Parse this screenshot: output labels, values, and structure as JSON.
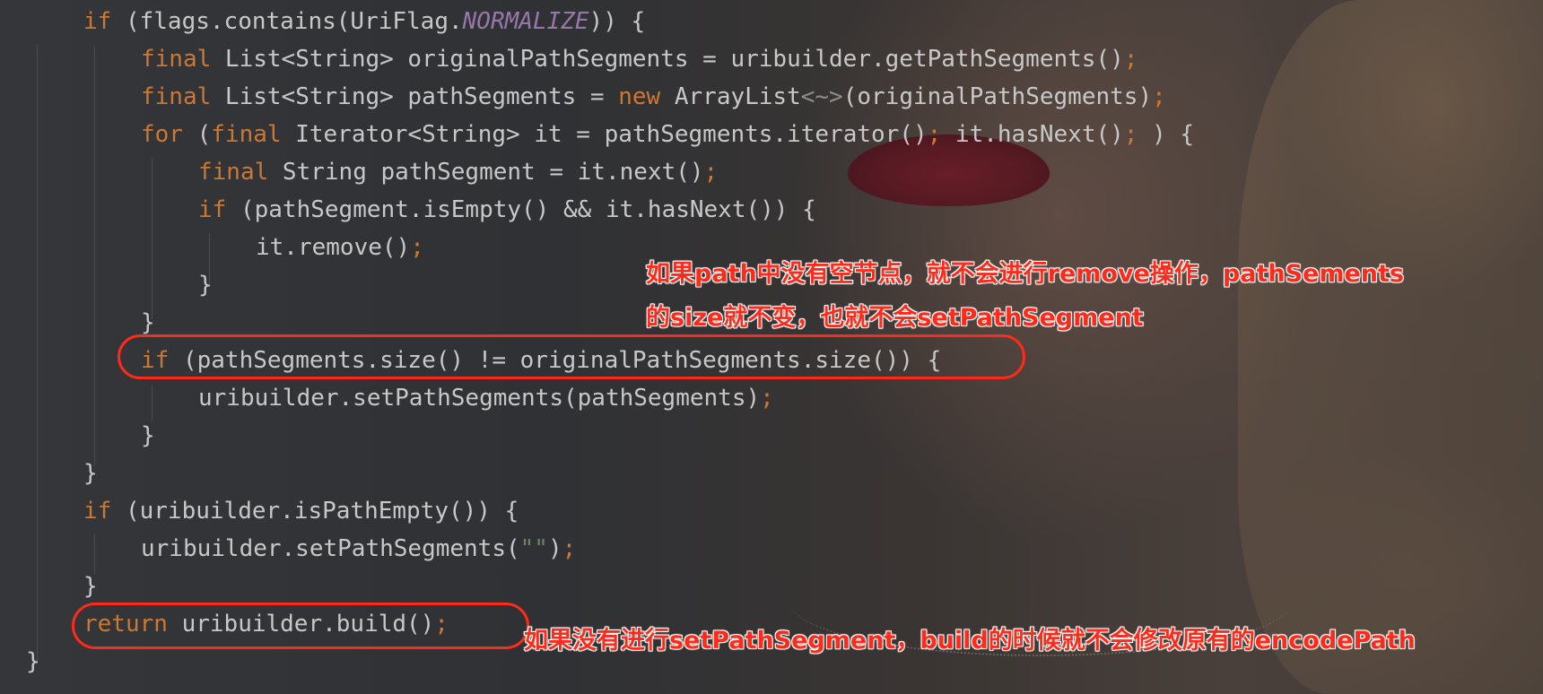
{
  "code": {
    "lines": [
      [
        {
          "t": "kw",
          "v": "if"
        },
        {
          "t": "tx",
          "v": " (flags.contains(UriFlag."
        },
        {
          "t": "const",
          "v": "NORMALIZE"
        },
        {
          "t": "tx",
          "v": ")) {"
        }
      ],
      [
        {
          "t": "kw",
          "v": "final"
        },
        {
          "t": "tx",
          "v": " List<String> originalPathSegments = uribuilder.getPathSegments()"
        },
        {
          "t": "kw",
          "v": ";"
        }
      ],
      [
        {
          "t": "kw",
          "v": "final"
        },
        {
          "t": "tx",
          "v": " List<String> pathSegments = "
        },
        {
          "t": "kw",
          "v": "new"
        },
        {
          "t": "tx",
          "v": " ArrayList"
        },
        {
          "t": "gray",
          "v": "<~>"
        },
        {
          "t": "tx",
          "v": "(originalPathSegments)"
        },
        {
          "t": "kw",
          "v": ";"
        }
      ],
      [
        {
          "t": "kw",
          "v": "for"
        },
        {
          "t": "tx",
          "v": " ("
        },
        {
          "t": "kw",
          "v": "final"
        },
        {
          "t": "tx",
          "v": " Iterator<String> it = pathSegments.iterator()"
        },
        {
          "t": "kw",
          "v": ";"
        },
        {
          "t": "tx",
          "v": " it.hasNext()"
        },
        {
          "t": "kw",
          "v": ";"
        },
        {
          "t": "tx",
          "v": " ) {"
        }
      ],
      [
        {
          "t": "kw",
          "v": "final"
        },
        {
          "t": "tx",
          "v": " String pathSegment = it.next()"
        },
        {
          "t": "kw",
          "v": ";"
        }
      ],
      [
        {
          "t": "kw",
          "v": "if"
        },
        {
          "t": "tx",
          "v": " (pathSegment.isEmpty() && it.hasNext()) {"
        }
      ],
      [
        {
          "t": "tx",
          "v": "it.remove()"
        },
        {
          "t": "kw",
          "v": ";"
        }
      ],
      [
        {
          "t": "tx",
          "v": "}"
        }
      ],
      [
        {
          "t": "tx",
          "v": "}"
        }
      ],
      [
        {
          "t": "kw",
          "v": "if"
        },
        {
          "t": "tx",
          "v": " (pathSegments.size() != originalPathSegments.size()) {"
        }
      ],
      [
        {
          "t": "tx",
          "v": "uribuilder.setPathSegments(pathSegments)"
        },
        {
          "t": "kw",
          "v": ";"
        }
      ],
      [
        {
          "t": "tx",
          "v": "}"
        }
      ],
      [
        {
          "t": "tx",
          "v": "}"
        }
      ],
      [
        {
          "t": "kw",
          "v": "if"
        },
        {
          "t": "tx",
          "v": " (uribuilder.isPathEmpty()) {"
        }
      ],
      [
        {
          "t": "tx",
          "v": "uribuilder.setPathSegments("
        },
        {
          "t": "str",
          "v": "\"\""
        },
        {
          "t": "tx",
          "v": ")"
        },
        {
          "t": "kw",
          "v": ";"
        }
      ],
      [
        {
          "t": "tx",
          "v": "}"
        }
      ],
      [
        {
          "t": "kw",
          "v": "return"
        },
        {
          "t": "tx",
          "v": " uribuilder.build()"
        },
        {
          "t": "kw",
          "v": ";"
        }
      ],
      [
        {
          "t": "tx",
          "v": "}"
        }
      ]
    ]
  },
  "annotations": {
    "note_1_line_1": "如果path中没有空节点，就不会进行remove操作，pathSements",
    "note_1_line_2": "的size就不变，也就不会setPathSegment",
    "note_2": "如果没有进行setPathSegment，build的时候就不会修改原有的encodePath"
  },
  "colors": {
    "keyword": "#cc7832",
    "text": "#c8c8c8",
    "constant": "#9876aa",
    "string": "#6a8759",
    "annotation": "#ff2a1a"
  }
}
